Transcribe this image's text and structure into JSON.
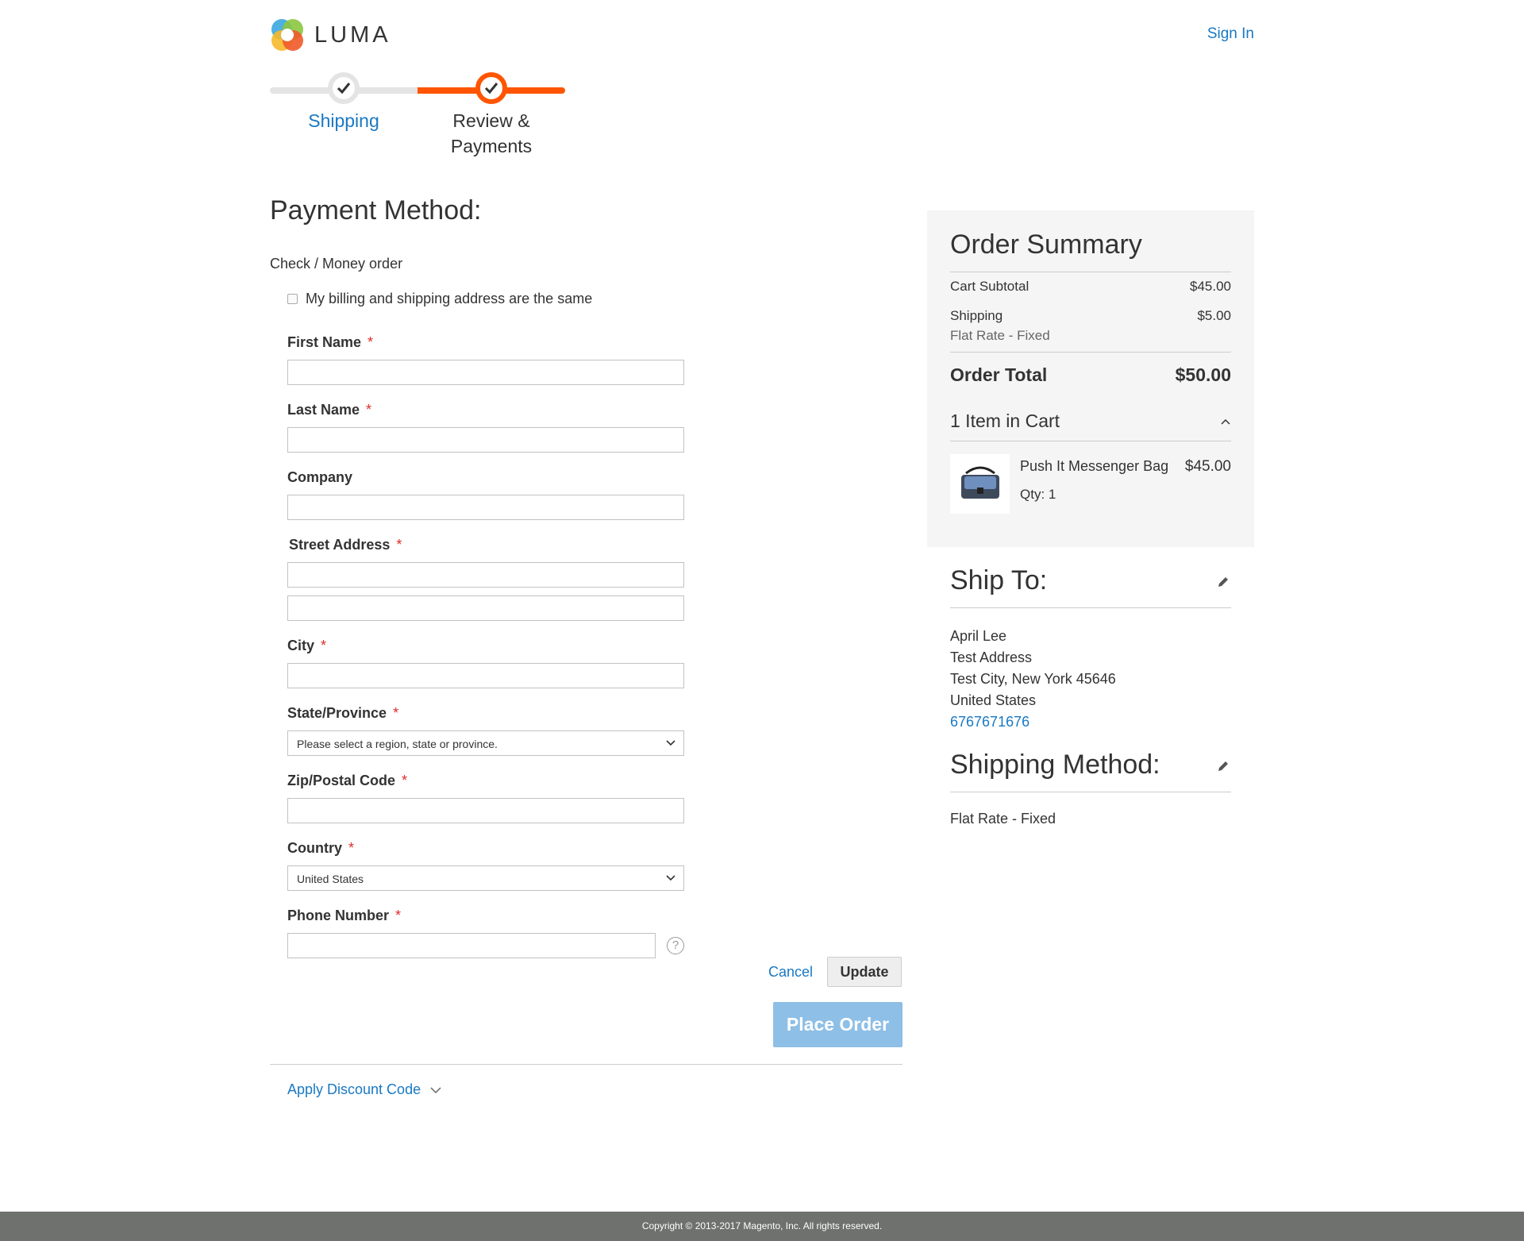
{
  "header": {
    "brand": "LUMA",
    "sign_in": "Sign In"
  },
  "progress": {
    "steps": [
      {
        "label": "Shipping",
        "state": "complete"
      },
      {
        "label": "Review & Payments",
        "state": "active"
      }
    ]
  },
  "payment": {
    "title": "Payment Method:",
    "method_label": "Check / Money order",
    "same_address_label": "My billing and shipping address are the same",
    "same_address_checked": false,
    "fields": {
      "first_name": {
        "label": "First Name",
        "value": ""
      },
      "last_name": {
        "label": "Last Name",
        "value": ""
      },
      "company": {
        "label": "Company",
        "value": ""
      },
      "street": {
        "label": "Street Address",
        "line1": "",
        "line2": ""
      },
      "city": {
        "label": "City",
        "value": ""
      },
      "state": {
        "label": "State/Province",
        "value": "Please select a region, state or province."
      },
      "zip": {
        "label": "Zip/Postal Code",
        "value": ""
      },
      "country": {
        "label": "Country",
        "value": "United States"
      },
      "phone": {
        "label": "Phone Number",
        "value": ""
      }
    },
    "required_mark": "*",
    "cancel": "Cancel",
    "update": "Update",
    "place_order": "Place Order",
    "discount": "Apply Discount Code"
  },
  "summary": {
    "title": "Order Summary",
    "cart_subtotal_label": "Cart Subtotal",
    "cart_subtotal": "$45.00",
    "shipping_label": "Shipping",
    "shipping_value": "$5.00",
    "shipping_method": "Flat Rate - Fixed",
    "order_total_label": "Order Total",
    "order_total": "$50.00",
    "items_label": "1 Item in Cart",
    "item": {
      "name": "Push It Messenger Bag",
      "price": "$45.00",
      "qty": "Qty: 1"
    }
  },
  "ship_to": {
    "title": "Ship To:",
    "name": "April Lee",
    "street": "Test Address",
    "city_line": "Test City, New York 45646",
    "country": "United States",
    "phone": "6767671676"
  },
  "shipping_method": {
    "title": "Shipping Method:",
    "value": "Flat Rate - Fixed"
  },
  "footer": {
    "copyright": "Copyright © 2013-2017 Magento, Inc. All rights reserved."
  },
  "colors": {
    "accent_orange": "#ff5501",
    "link_blue": "#1979c3",
    "place_order_bg": "#8ebfe6",
    "footer_bg": "#6e716e"
  }
}
